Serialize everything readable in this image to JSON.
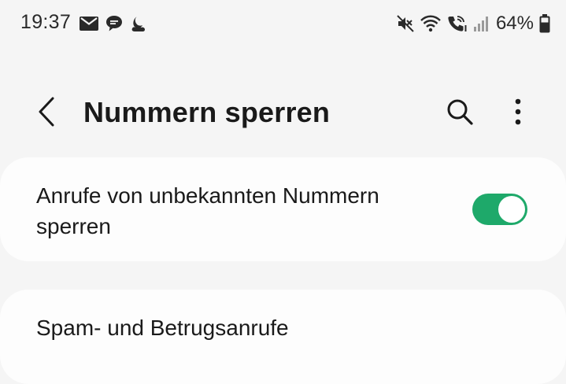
{
  "status_bar": {
    "time": "19:37",
    "left_icons": [
      "mail-icon",
      "chat-bubble-icon",
      "weather-icon"
    ],
    "right_icons": [
      "mute-icon",
      "wifi-icon",
      "wifi-calling-icon",
      "signal-icon",
      "battery-icon"
    ],
    "battery_percent": "64%"
  },
  "header": {
    "title": "Nummern sperren",
    "back_icon": "chevron-left-icon",
    "search_icon": "search-icon",
    "more_icon": "more-vertical-icon"
  },
  "settings": {
    "block_unknown_label": "Anrufe von unbekannten Nummern sperren",
    "block_unknown_enabled": true,
    "accent_color": "#1ea96a"
  },
  "next_section": {
    "label": "Spam- und Betrugsanrufe"
  }
}
